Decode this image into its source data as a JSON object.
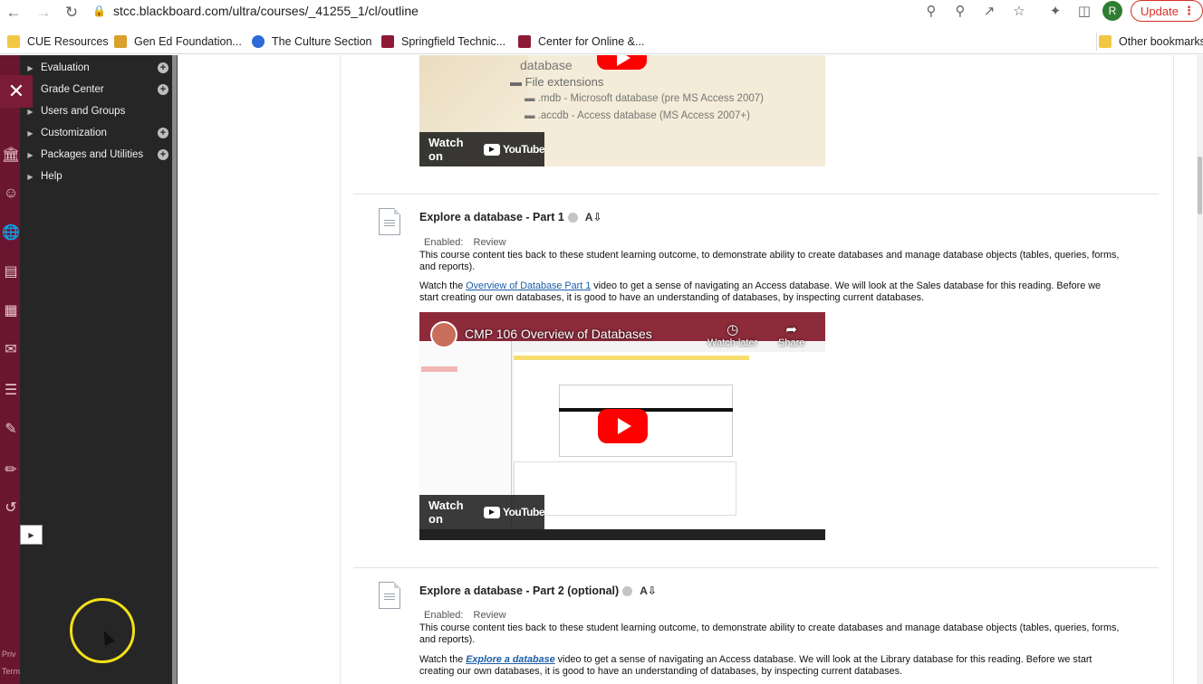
{
  "browser": {
    "url": "stcc.blackboard.com/ultra/courses/_41255_1/cl/outline",
    "avatar_letter": "R",
    "update_label": "Update"
  },
  "bookmarks": [
    {
      "label": "CUE Resources",
      "icon": "folder-icon"
    },
    {
      "label": "Gen Ed Foundation...",
      "icon": "bookmark-site-icon"
    },
    {
      "label": "The Culture Section",
      "icon": "bookmark-site-icon"
    },
    {
      "label": "Springfield Technic...",
      "icon": "stcc-icon"
    },
    {
      "label": "Center for Online &...",
      "icon": "stcc-icon"
    }
  ],
  "other_bookmarks": "Other bookmarks",
  "course_menu": {
    "items": [
      {
        "label": "Evaluation",
        "has_add": true
      },
      {
        "label": "Grade Center",
        "has_add": true
      },
      {
        "label": "Users and Groups",
        "has_add": false
      },
      {
        "label": "Customization",
        "has_add": true
      },
      {
        "label": "Packages and Utilities",
        "has_add": true
      },
      {
        "label": "Help",
        "has_add": false
      }
    ]
  },
  "rail_footer": {
    "privacy": "Priv",
    "terms": "Term"
  },
  "video1": {
    "slide_lines": [
      "database",
      "File extensions",
      ".mdb - Microsoft database (pre MS Access 2007)",
      ".accdb - Access database (MS Access 2007+)"
    ],
    "watch_on": "Watch on",
    "yt": "YouTube"
  },
  "items": [
    {
      "title": "Explore a database - Part 1",
      "enabled_label": "Enabled:",
      "review_label": "Review",
      "desc": "This course content ties back to these student learning outcome, to demonstrate ability to create databases and manage database objects (tables, queries, forms, and reports).",
      "watch_prefix": "Watch the ",
      "link_text": "Overview of Database Part 1",
      "watch_suffix": " video to get a sense of navigating an Access database. We will look at the Sales database for this reading. Before we start creating our own databases, it is good to have an understanding of databases, by inspecting current databases.",
      "video": {
        "title": "CMP 106 Overview of Databases",
        "watch_later": "Watch later",
        "share": "Share",
        "watch_on": "Watch on",
        "yt": "YouTube"
      }
    },
    {
      "title": "Explore a database - Part 2 (optional)",
      "enabled_label": "Enabled:",
      "review_label": "Review",
      "desc": "This course content ties back to these student learning outcome, to demonstrate ability to create databases and manage database objects (tables, queries, forms, and reports).",
      "watch_prefix": "Watch the ",
      "link_text": "Explore a database",
      "watch_suffix": " video to get a sense of navigating an Access database. We will look at the Library database for this reading. Before we start creating our own databases, it is good to have an understanding of databases, by inspecting current databases."
    }
  ],
  "colors": {
    "rail": "#6b1630",
    "menu": "#262626",
    "link": "#1a5ea8",
    "update": "#d93025"
  }
}
